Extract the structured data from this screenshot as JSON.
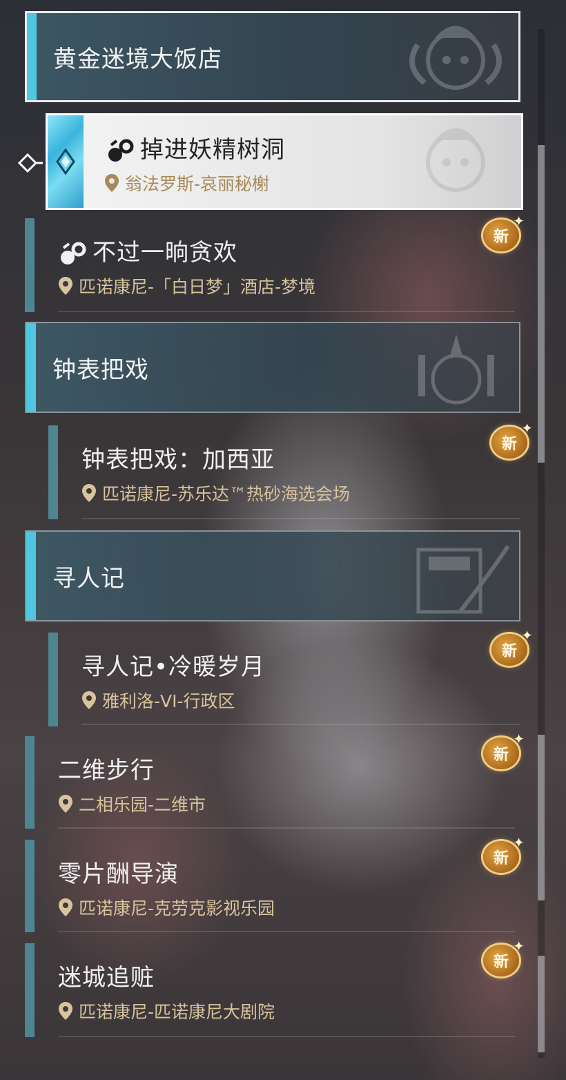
{
  "badge_text": "新",
  "colors": {
    "accent_cyan": "#4fc7e0",
    "bar_teal": "#4d8593",
    "location_gold": "#d8c39d",
    "badge_gold": "#e3a441"
  },
  "groups": [
    {
      "title": "黄金迷境大饭店",
      "icon": "chef-emblem-icon",
      "quests": [
        {
          "name": "掉进妖精树洞",
          "location": "翁法罗斯-哀丽秘榭",
          "selected": true,
          "is_new": false,
          "has_type_icon": true
        },
        {
          "name": "不过一晌贪欢",
          "location": "匹诺康尼-「白日梦」酒店-梦境",
          "selected": false,
          "is_new": true,
          "has_type_icon": true
        }
      ]
    },
    {
      "title": "钟表把戏",
      "icon": "clockwork-emblem-icon",
      "quests": [
        {
          "name": "钟表把戏：加西亚",
          "location": "匹诺康尼-苏乐达™热砂海选会场",
          "selected": false,
          "is_new": true,
          "has_type_icon": false
        }
      ]
    },
    {
      "title": "寻人记",
      "icon": "quill-document-emblem-icon",
      "quests": [
        {
          "name": "寻人记•冷暖岁月",
          "location": "雅利洛-VI-行政区",
          "selected": false,
          "is_new": true,
          "has_type_icon": false
        }
      ]
    }
  ],
  "quests": [
    {
      "name": "二维步行",
      "location": "二相乐园-二维市",
      "is_new": true
    },
    {
      "name": "零片酬导演",
      "location": "匹诺康尼-克劳克影视乐园",
      "is_new": true
    },
    {
      "name": "迷城追赃",
      "location": "匹诺康尼-匹诺康尼大剧院",
      "is_new": true
    }
  ]
}
